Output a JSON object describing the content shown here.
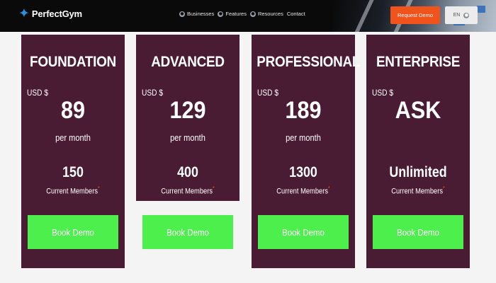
{
  "header": {
    "logo_text": "PerfectGym",
    "logo_icon": "star-icon",
    "nav": [
      {
        "label": "Businesses",
        "icon": "globe-icon"
      },
      {
        "label": "Features",
        "icon": "globe-icon"
      },
      {
        "label": "Resources",
        "icon": "globe-icon"
      },
      {
        "label": "Contact"
      }
    ],
    "request_demo": "Request Demo",
    "language": "EN",
    "accent_color": "#f0531c"
  },
  "plans": [
    {
      "name": "FOUNDATION",
      "currency": "USD $",
      "price": "89",
      "period": "per month",
      "members": "150",
      "members_label": "Current Members",
      "cta": "Book Demo"
    },
    {
      "name": "ADVANCED",
      "currency": "USD $",
      "price": "129",
      "period": "per month",
      "members": "400",
      "members_label": "Current Members",
      "cta": "Book Demo"
    },
    {
      "name": "PROFESSIONAL",
      "currency": "USD $",
      "price": "189",
      "period": "per month",
      "members": "1300",
      "members_label": "Current Members",
      "cta": "Book Demo"
    },
    {
      "name": "ENTERPRISE",
      "currency": "USD $",
      "price": "ASK",
      "period": "",
      "members": "Unlimited",
      "members_label": "Current Members",
      "cta": "Book Demo"
    }
  ],
  "colors": {
    "card_bg": "#4a1c33",
    "cta_bg": "#4def4d",
    "page_bg": "#f4f4f4"
  }
}
